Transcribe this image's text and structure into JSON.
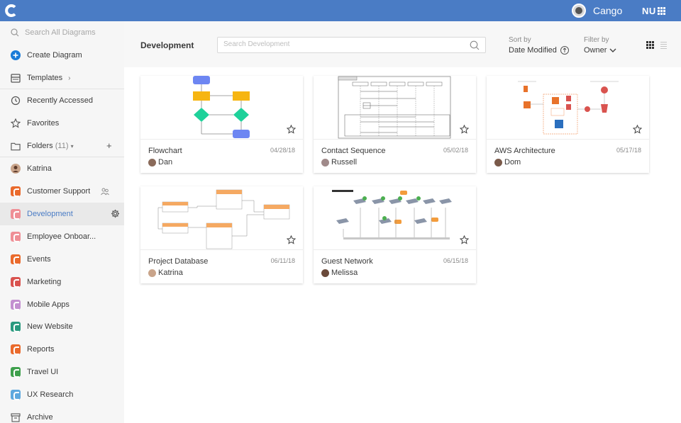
{
  "topbar": {
    "team_name": "Cango",
    "brand": "NU"
  },
  "sidebar": {
    "search_placeholder": "Search All Diagrams",
    "create": "Create Diagram",
    "templates": "Templates",
    "recently": "Recently Accessed",
    "favorites": "Favorites",
    "folders": "Folders",
    "folders_count": "(11)",
    "user": "Katrina",
    "folder_items": [
      {
        "label": "Customer Support",
        "color": "#ea6a2c"
      },
      {
        "label": "Development",
        "color": "#ef8f96"
      },
      {
        "label": "Employee Onboar...",
        "color": "#ef8f96"
      },
      {
        "label": "Events",
        "color": "#ea6a2c"
      },
      {
        "label": "Marketing",
        "color": "#d9534f"
      },
      {
        "label": "Mobile Apps",
        "color": "#c38fd0"
      },
      {
        "label": "New Website",
        "color": "#2a9a7f"
      },
      {
        "label": "Reports",
        "color": "#ea6a2c"
      },
      {
        "label": "Travel UI",
        "color": "#3fa04d"
      },
      {
        "label": "UX Research",
        "color": "#5da8de"
      }
    ],
    "archive": "Archive"
  },
  "header": {
    "title": "Development",
    "search_placeholder": "Search Development",
    "sort_label": "Sort by",
    "sort_value": "Date Modified",
    "filter_label": "Filter by",
    "filter_value": "Owner"
  },
  "cards": [
    {
      "title": "Flowchart",
      "date": "04/28/18",
      "owner": "Dan"
    },
    {
      "title": "Contact Sequence",
      "date": "05/02/18",
      "owner": "Russell"
    },
    {
      "title": "AWS Architecture",
      "date": "05/17/18",
      "owner": "Dom"
    },
    {
      "title": "Project Database",
      "date": "06/11/18",
      "owner": "Katrina"
    },
    {
      "title": "Guest Network",
      "date": "06/15/18",
      "owner": "Melissa"
    }
  ],
  "colors": {
    "accent": "#4a7cc5"
  },
  "icons": [
    "logo-icon",
    "search-icon",
    "plus-circle-icon",
    "templates-icon",
    "history-icon",
    "star-icon",
    "folder-icon",
    "gear-icon",
    "shared-users-icon",
    "archive-icon",
    "grid-view-icon",
    "list-view-icon"
  ]
}
